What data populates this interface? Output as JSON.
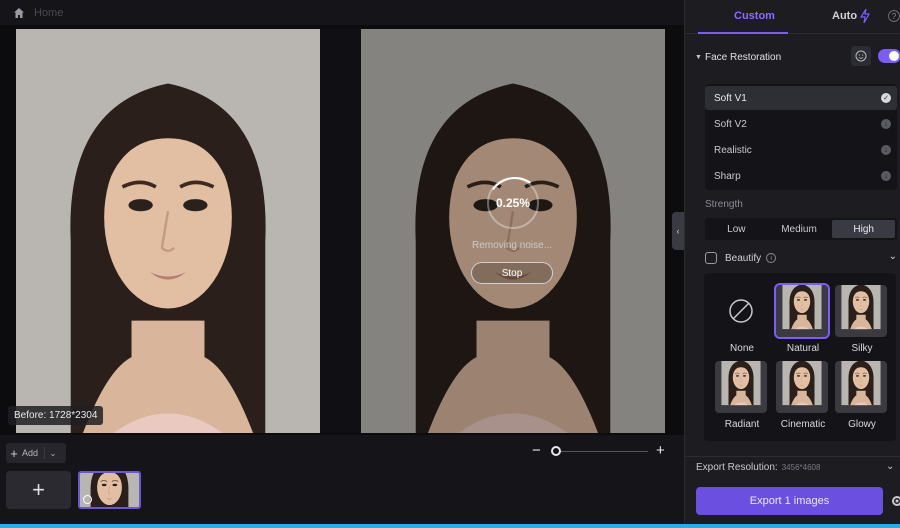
{
  "topbar": {
    "crumb": "Home"
  },
  "preview": {
    "before_label": "Before: 1728*2304",
    "progress_percent": "0.25%",
    "progress_value": 0.0025,
    "status": "Removing noise...",
    "stop_label": "Stop"
  },
  "toolbar": {
    "add_label": "Add",
    "zoom_minus": "−",
    "zoom_plus": "+",
    "zoom_level": 0.0
  },
  "panel": {
    "tabs": [
      {
        "label": "Custom",
        "active": true
      },
      {
        "label": "Auto",
        "active": false
      }
    ],
    "help": "?",
    "face_restoration": {
      "label": "Face Restoration",
      "enabled": true,
      "modes": [
        {
          "label": "Soft V1",
          "status": "selected"
        },
        {
          "label": "Soft V2",
          "status": "download"
        },
        {
          "label": "Realistic",
          "status": "download"
        },
        {
          "label": "Sharp",
          "status": "download"
        }
      ]
    },
    "strength": {
      "label": "Strength",
      "options": [
        "Low",
        "Medium",
        "High"
      ],
      "selected": "High"
    },
    "beautify": {
      "label": "Beautify",
      "info": "i",
      "styles": [
        {
          "name": "None"
        },
        {
          "name": "Natural",
          "selected": true
        },
        {
          "name": "Silky"
        },
        {
          "name": "Radiant"
        },
        {
          "name": "Cinematic"
        },
        {
          "name": "Glowy"
        }
      ]
    },
    "export": {
      "resolution_label": "Export Resolution:",
      "resolution_value": "3456*4608",
      "button": "Export 1 images"
    }
  },
  "colors": {
    "accent": "#7c5cff",
    "export_button": "#6b4fe0",
    "bottom_line": "#27aee8"
  }
}
